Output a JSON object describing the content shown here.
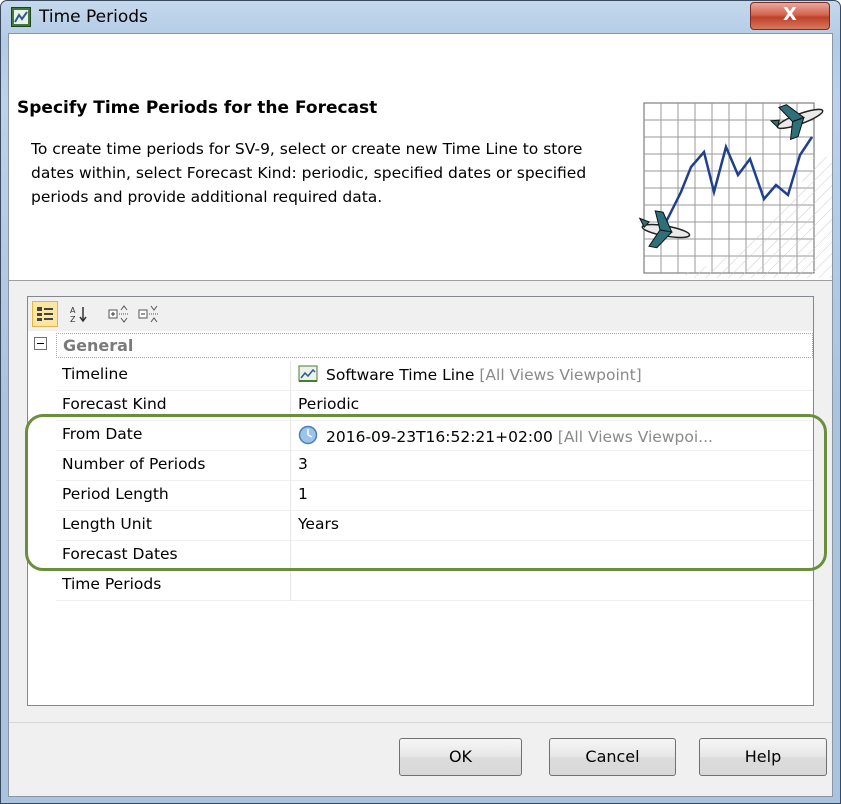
{
  "window": {
    "title": "Time Periods",
    "close_glyph": "X"
  },
  "header": {
    "title": "Specify Time Periods for the Forecast",
    "description": "To create time periods for SV-9, select or create new Time Line to store dates within, select Forecast Kind: periodic, specified dates or specified periods and provide additional required data."
  },
  "toolbar": {
    "buttons": [
      {
        "icon": "categorized-view-icon",
        "active": true
      },
      {
        "icon": "sort-alphabetical-icon",
        "active": false
      },
      {
        "icon": "expand-all-icon",
        "active": false
      },
      {
        "icon": "collapse-all-icon",
        "active": false
      }
    ]
  },
  "properties": {
    "group_label": "General",
    "rows": [
      {
        "name": "Timeline",
        "value": "Software Time Line",
        "suffix": "[All Views Viewpoint]",
        "icon": "timeline-icon"
      },
      {
        "name": "Forecast Kind",
        "value": "Periodic",
        "suffix": "",
        "icon": ""
      },
      {
        "name": "From Date",
        "value": "2016-09-23T16:52:21+02:00",
        "suffix": "[All Views Viewpoi...",
        "icon": "clock-icon"
      },
      {
        "name": "Number of Periods",
        "value": "3",
        "suffix": "",
        "icon": ""
      },
      {
        "name": "Period Length",
        "value": "1",
        "suffix": "",
        "icon": ""
      },
      {
        "name": "Length Unit",
        "value": "Years",
        "suffix": "",
        "icon": ""
      },
      {
        "name": "Forecast Dates",
        "value": "",
        "suffix": "",
        "icon": ""
      },
      {
        "name": "Time Periods",
        "value": "",
        "suffix": "",
        "icon": ""
      }
    ]
  },
  "buttons": {
    "ok": "OK",
    "cancel": "Cancel",
    "help": "Help"
  },
  "colors": {
    "highlight_border": "#6b8e3c",
    "chart_line": "#1f3f8f",
    "group_focus_border": "#e8a23a"
  }
}
